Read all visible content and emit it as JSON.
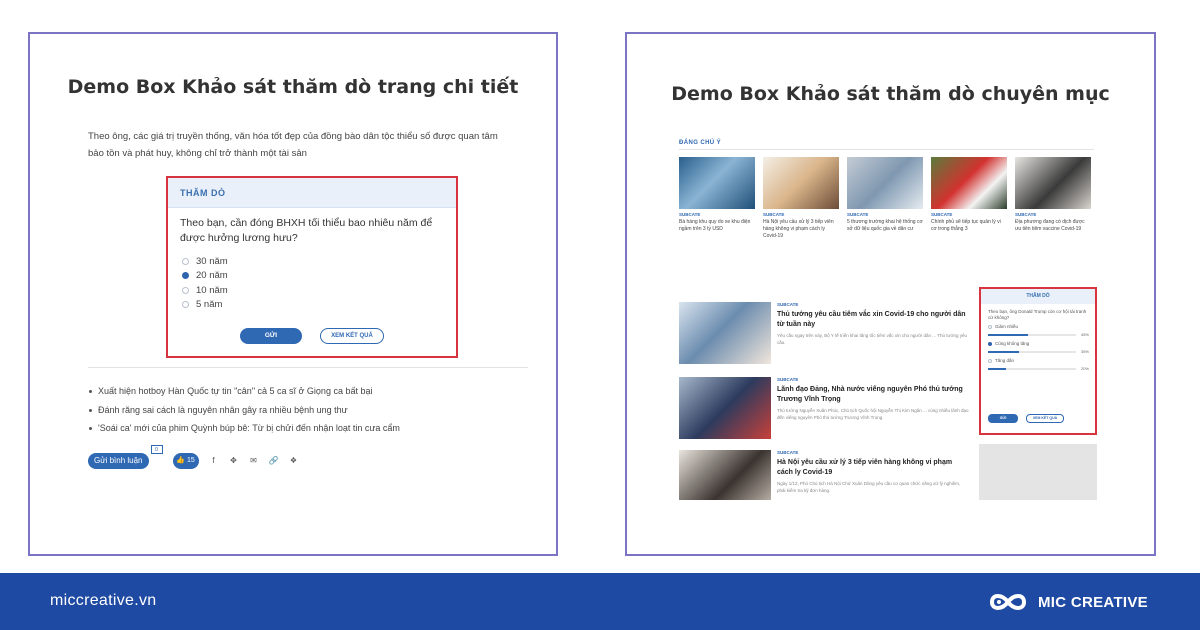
{
  "left_panel": {
    "title": "Demo Box Khảo sát thăm dò trang chi tiết",
    "intro": "Theo ông, các giá trị truyền thống, văn hóa tốt đẹp của đồng bào dân tộc thiểu số được quan tâm bảo tồn và phát huy, không chỉ trở thành một tài sản",
    "poll": {
      "header": "THĂM DÒ",
      "question": "Theo bạn, cần đóng BHXH tối thiểu bao nhiêu năm để được hưởng lương hưu?",
      "options": [
        "30 năm",
        "20 năm",
        "10 năm",
        "5 năm"
      ],
      "selected_index": 1,
      "send_label": "GỬI",
      "result_label": "XEM KẾT QUẢ"
    },
    "related": [
      "Xuất hiện hotboy Hàn Quốc tự tin \"cân\" cả 5 ca sĩ ở Giọng ca bất bại",
      "Đánh răng sai cách là nguyên nhân gây ra nhiều bệnh ung thư",
      "'Soái ca' mới của phim Quỳnh búp bê: Từ bị chửi đến nhận loạt tin cưa cẩm"
    ],
    "actions": {
      "comment_label": "Gửi bình luận",
      "comment_count": "0",
      "like_count": "15"
    }
  },
  "right_panel": {
    "title": "Demo Box Khảo sát thăm dò chuyên mục",
    "section_label": "ĐÁNG CHÚ Ý",
    "thumbs": [
      {
        "cat": "SUBCATE",
        "title": "Bà hàng khu quy do xe khu điện ngầm trên 3 tỷ USD"
      },
      {
        "cat": "SUBCATE",
        "title": "Hà Nội yêu cầu xử lý 3 tiếp viên hàng không vi phạm cách ly Covid-19"
      },
      {
        "cat": "SUBCATE",
        "title": "5 thương trường khai hệ thống cơ sở dữ liệu quốc gia về dân cư"
      },
      {
        "cat": "SUBCATE",
        "title": "Chính phủ sẽ tiếp tục quản lý vi cơ trong thắng 3"
      },
      {
        "cat": "SUBCATE",
        "title": "Địa phương đang có dịch được ưu tiên tiêm vaccine Covid-19"
      }
    ],
    "news": [
      {
        "cat": "SUBCATE",
        "title": "Thủ tướng yêu cầu tiêm vắc xin Covid-19 cho người dân từ tuần này",
        "summary": "Yêu cầu ngay trên này, Bộ Y tế triển khai tăng tốc tiêm vắc xin cho người dân ... Thủ tướng yêu cầu."
      },
      {
        "cat": "SUBCATE",
        "title": "Lãnh đạo Đảng, Nhà nước viếng nguyên Phó thủ tướng Trương Vĩnh Trọng",
        "summary": "Thủ tướng Nguyễn Xuân Phúc, Chủ tịch Quốc hội Nguyễn Thị Kim Ngân ... cùng nhiều lãnh đạo đến viếng nguyên Phó thủ tướng Trương Vĩnh Trọng."
      },
      {
        "cat": "SUBCATE",
        "title": "Hà Nội yêu cầu xử lý 3 tiếp viên hàng không vi phạm cách ly Covid-19",
        "summary": "Ngày 1/12, Phó Chủ tịch Hà Nội Chử Xuân Dũng yêu cầu cơ quan chức năng xử lý nghiêm, phải kiểm tra kỹ đơn hàng."
      }
    ],
    "mini_poll": {
      "header": "THĂM DÒ",
      "question": "Theo bạn, ông Donald Trump còn cơ hội tái tranh cử không?",
      "options": [
        {
          "label": "Giảm nhiều",
          "percent": "45%",
          "value": 45
        },
        {
          "label": "Cũng không tăng",
          "percent": "35%",
          "value": 35
        },
        {
          "label": "Tăng dần",
          "percent": "20%",
          "value": 20
        }
      ],
      "selected_index": 1,
      "send_label": "GỬI",
      "result_label": "XEM KẾT QUẢ"
    }
  },
  "footer": {
    "site": "miccreative.vn",
    "brand": "MIC CREATIVE"
  },
  "colors": {
    "footer_bg": "#1f4aa3",
    "panel_border": "#7b73c4",
    "highlight_border": "#d8343f",
    "accent_blue": "#2f68b3"
  }
}
